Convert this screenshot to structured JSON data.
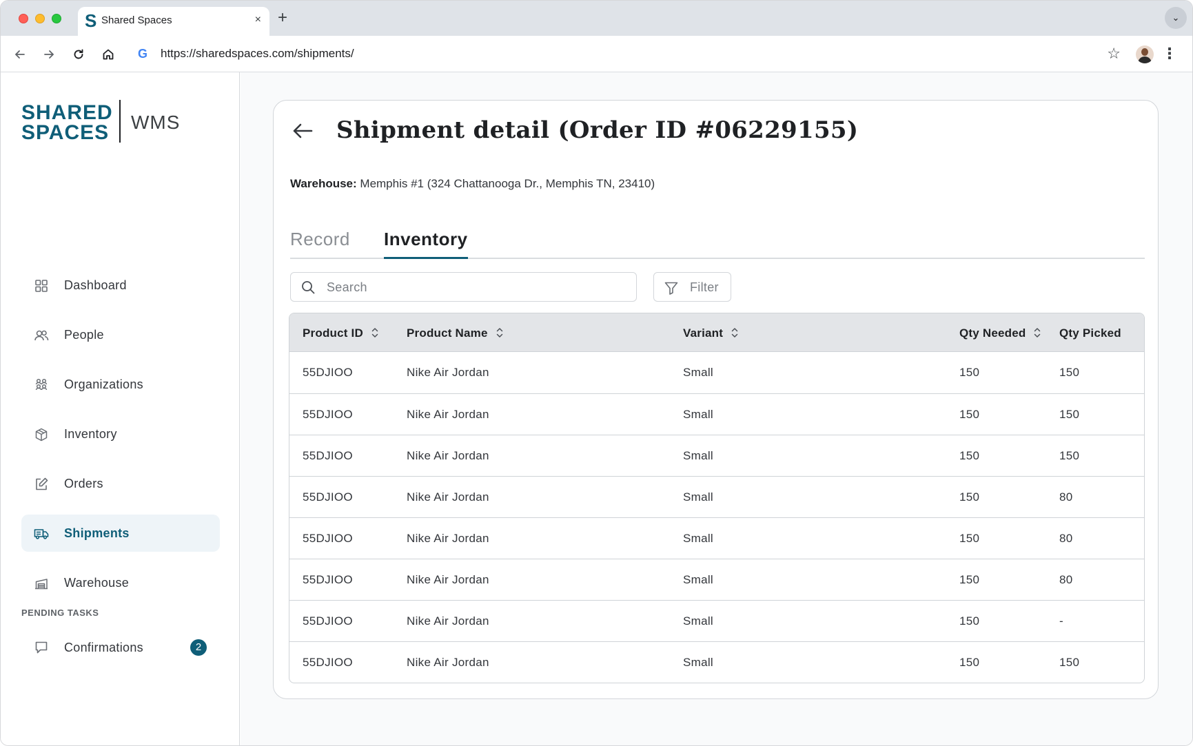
{
  "browser": {
    "tab_title": "Shared Spaces",
    "tab_favicon": "S",
    "tab_close": "×",
    "new_tab": "+",
    "tab_menu": "⌄",
    "url": "https://sharedspaces.com/shipments/",
    "google_icon": "G",
    "star_icon": "☆",
    "kebab_icon": "⋮"
  },
  "sidebar": {
    "logo_line1": "SHARED",
    "logo_line2": "SPACES",
    "logo_product": "WMS",
    "nav": [
      {
        "label": "Dashboard",
        "icon": "dashboard-icon"
      },
      {
        "label": "People",
        "icon": "people-icon"
      },
      {
        "label": "Organizations",
        "icon": "organizations-icon"
      },
      {
        "label": "Inventory",
        "icon": "box-icon"
      },
      {
        "label": "Orders",
        "icon": "edit-icon"
      },
      {
        "label": "Shipments",
        "icon": "truck-icon",
        "active": true
      },
      {
        "label": "Warehouse",
        "icon": "warehouse-icon"
      }
    ],
    "pending_title": "PENDING TASKS",
    "pending_items": [
      {
        "label": "Confirmations",
        "badge": "2",
        "icon": "confirmations-icon"
      }
    ]
  },
  "main": {
    "title": "Shipment detail (Order ID #06229155)",
    "warehouse_label": "Warehouse:",
    "warehouse_value": "Memphis #1 (324 Chattanooga Dr., Memphis TN, 23410)",
    "tabs": [
      "Record",
      "Inventory"
    ],
    "active_tab": "Inventory",
    "search_placeholder": "Search",
    "filter_label": "Filter",
    "table": {
      "columns": [
        "Product ID",
        "Product Name",
        "Variant",
        "Qty Needed",
        "Qty Picked"
      ],
      "rows": [
        [
          "55DJIOO",
          "Nike Air Jordan",
          "Small",
          "150",
          "150"
        ],
        [
          "55DJIOO",
          "Nike Air Jordan",
          "Small",
          "150",
          "150"
        ],
        [
          "55DJIOO",
          "Nike Air Jordan",
          "Small",
          "150",
          "150"
        ],
        [
          "55DJIOO",
          "Nike Air Jordan",
          "Small",
          "150",
          "80"
        ],
        [
          "55DJIOO",
          "Nike Air Jordan",
          "Small",
          "150",
          "80"
        ],
        [
          "55DJIOO",
          "Nike Air Jordan",
          "Small",
          "150",
          "80"
        ],
        [
          "55DJIOO",
          "Nike Air Jordan",
          "Small",
          "150",
          "-"
        ],
        [
          "55DJIOO",
          "Nike Air Jordan",
          "Small",
          "150",
          "150"
        ]
      ]
    }
  },
  "colors": {
    "brand": "#0f5e78",
    "active_nav_bg": "#eef4f8",
    "table_header_bg": "#e3e5e8"
  }
}
